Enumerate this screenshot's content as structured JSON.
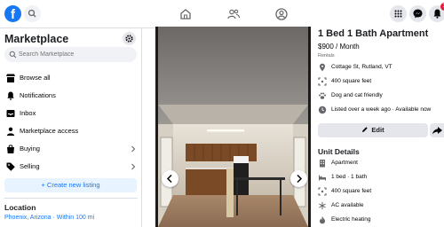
{
  "topbar": {
    "logo": "f",
    "notification_count": "1"
  },
  "sidebar": {
    "title": "Marketplace",
    "search_placeholder": "Search Marketplace",
    "items": [
      {
        "label": "Browse all",
        "icon": "store-icon"
      },
      {
        "label": "Notifications",
        "icon": "bell-icon"
      },
      {
        "label": "Inbox",
        "icon": "inbox-icon"
      },
      {
        "label": "Marketplace access",
        "icon": "person-icon"
      },
      {
        "label": "Buying",
        "icon": "bag-icon"
      },
      {
        "label": "Selling",
        "icon": "tag-icon"
      }
    ],
    "create_label": "+ Create new listing",
    "location_title": "Location",
    "location_value": "Phoenix, Arizona · Within 100 mi"
  },
  "listing": {
    "title": "1 Bed 1 Bath Apartment",
    "price": "$900 / Month",
    "category": "Rentals",
    "facts": [
      {
        "icon": "pin-icon",
        "text": "Cottage St, Rutland, VT"
      },
      {
        "icon": "area-icon",
        "text": "400 square feet"
      },
      {
        "icon": "paw-icon",
        "text": "Dog and cat friendly"
      },
      {
        "icon": "clock-icon",
        "text": "Listed over a week ago · Available now"
      }
    ],
    "edit_label": "Edit",
    "unit_details_title": "Unit Details",
    "unit_details": [
      {
        "icon": "building-icon",
        "text": "Apartment"
      },
      {
        "icon": "bed-icon",
        "text": "1 bed · 1 bath"
      },
      {
        "icon": "area-icon",
        "text": "400 square feet"
      },
      {
        "icon": "snowflake-icon",
        "text": "AC available"
      },
      {
        "icon": "flame-icon",
        "text": "Electric heating"
      }
    ]
  }
}
